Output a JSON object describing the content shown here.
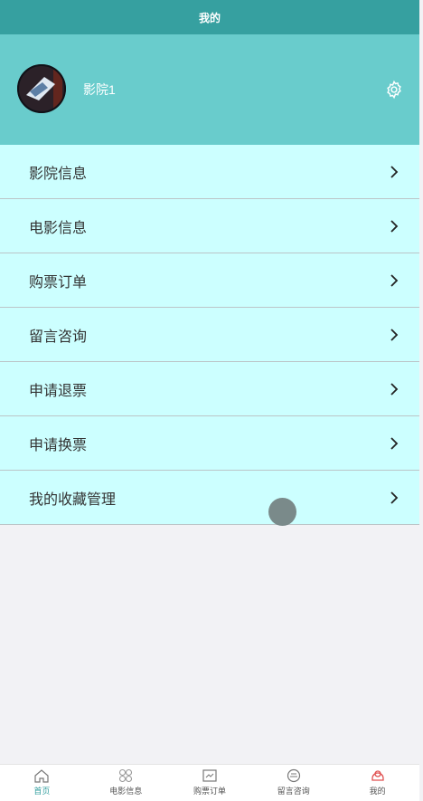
{
  "header": {
    "title": "我的"
  },
  "profile": {
    "username": "影院1",
    "avatar_icon": "avatar-image",
    "settings_icon": "gear-icon"
  },
  "menu": {
    "items": [
      {
        "label": "影院信息"
      },
      {
        "label": "电影信息"
      },
      {
        "label": "购票订单"
      },
      {
        "label": "留言咨询"
      },
      {
        "label": "申请退票"
      },
      {
        "label": "申请换票"
      },
      {
        "label": "我的收藏管理"
      }
    ]
  },
  "tabbar": {
    "items": [
      {
        "label": "首页",
        "icon": "home-icon"
      },
      {
        "label": "电影信息",
        "icon": "grid-icon"
      },
      {
        "label": "购票订单",
        "icon": "ticket-icon"
      },
      {
        "label": "留言咨询",
        "icon": "message-icon"
      },
      {
        "label": "我的",
        "icon": "user-icon"
      }
    ]
  },
  "colors": {
    "nav_bar": "#36a0a0",
    "profile_bg": "#69cccc",
    "menu_bg": "#ccffff",
    "page_bg": "#f2f2f5"
  }
}
